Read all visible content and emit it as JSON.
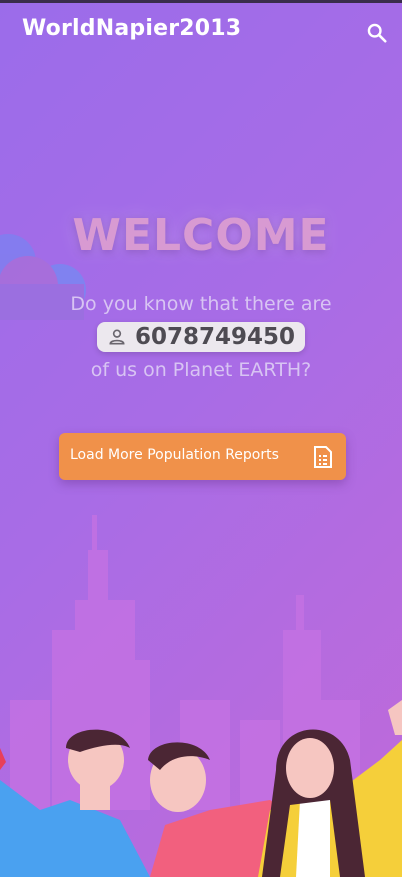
{
  "header": {
    "brand": "WorldNapier2013",
    "search_icon": "search-icon"
  },
  "hero": {
    "welcome": "WELCOME",
    "line1": "Do you know that there are",
    "population": "6078749450",
    "population_icon": "person-icon",
    "line2": "of us on Planet EARTH?"
  },
  "cta": {
    "label": "Load More Population Reports",
    "icon": "document-icon"
  },
  "colors": {
    "gradient_start": "#9b6cea",
    "gradient_end": "#c06ad9",
    "cta": "#f0914a",
    "welcome": "#d89ad2"
  }
}
